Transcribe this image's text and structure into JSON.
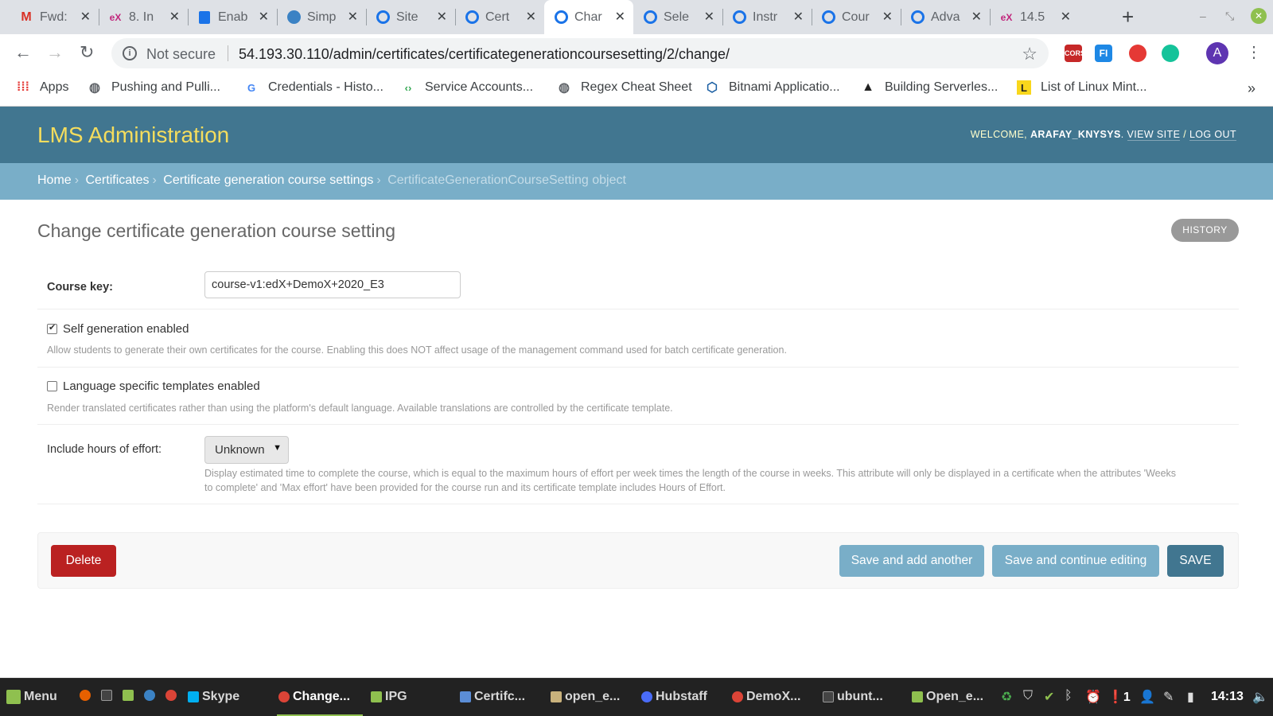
{
  "browser": {
    "tabs": [
      {
        "title": "Fwd:",
        "icon": "gmail-icon"
      },
      {
        "title": "8. In",
        "icon": "edx-icon"
      },
      {
        "title": "Enab",
        "icon": "doc-icon"
      },
      {
        "title": "Simp",
        "icon": "simple-icon"
      },
      {
        "title": "Site",
        "icon": "ring-icon"
      },
      {
        "title": "Cert",
        "icon": "ring-icon"
      },
      {
        "title": "Char",
        "icon": "ring-icon"
      },
      {
        "title": "Sele",
        "icon": "ring-icon"
      },
      {
        "title": "Instr",
        "icon": "ring-icon"
      },
      {
        "title": "Cour",
        "icon": "ring-icon"
      },
      {
        "title": "Adva",
        "icon": "ring-icon"
      },
      {
        "title": "14.5",
        "icon": "edx-icon"
      }
    ],
    "active_tab_index": 6,
    "security_label": "Not secure",
    "url": "54.193.30.110/admin/certificates/certificategenerationcoursesetting/2/change/",
    "avatar_letter": "A",
    "extensions": [
      "CORS",
      "FI",
      "",
      ""
    ],
    "bookmarks": [
      {
        "label": "Apps",
        "icon": "apps-grid-icon"
      },
      {
        "label": "Pushing and Pulli...",
        "icon": "globe-icon"
      },
      {
        "label": "Credentials - Histo...",
        "icon": "google-icon"
      },
      {
        "label": "Service Accounts...",
        "icon": "cloud-icon"
      },
      {
        "label": "Regex Cheat Sheet",
        "icon": "globe-icon"
      },
      {
        "label": "Bitnami Applicatio...",
        "icon": "bitnami-icon"
      },
      {
        "label": "Building Serverles...",
        "icon": "hat-icon"
      },
      {
        "label": "List of Linux Mint...",
        "icon": "l-icon"
      }
    ]
  },
  "admin": {
    "site_title": "LMS Administration",
    "welcome": "WELCOME,",
    "username": "ARAFAY_KNYSYS",
    "view_site": "VIEW SITE",
    "slash": "/",
    "log_out": "LOG OUT",
    "breadcrumbs": [
      "Home",
      "Certificates",
      "Certificate generation course settings"
    ],
    "breadcrumb_current": "CertificateGenerationCourseSetting object",
    "page_title": "Change certificate generation course setting",
    "history": "HISTORY",
    "fields": {
      "course_key": {
        "label": "Course key:",
        "value": "course-v1:edX+DemoX+2020_E3"
      },
      "self_generation": {
        "label": "Self generation enabled",
        "checked": true,
        "help": "Allow students to generate their own certificates for the course. Enabling this does NOT affect usage of the management command used for batch certificate generation."
      },
      "language_specific": {
        "label": "Language specific templates enabled",
        "checked": false,
        "help": "Render translated certificates rather than using the platform's default language. Available translations are controlled by the certificate template."
      },
      "hours_of_effort": {
        "label": "Include hours of effort:",
        "selected": "Unknown",
        "help_line1": "Display estimated time to complete the course, which is equal to the maximum hours of effort per week times the length of the course in weeks. This attribute will only be displayed in a certificate when the attributes 'Weeks",
        "help_line2": "to complete' and 'Max effort' have been provided for the course run and its certificate template includes Hours of Effort."
      }
    },
    "buttons": {
      "delete": "Delete",
      "save_add": "Save and add another",
      "save_continue": "Save and continue editing",
      "save": "SAVE"
    },
    "colors": {
      "header": "#417690",
      "breadcrumbs": "#79aec8",
      "title": "#f5dd5d",
      "delete": "#ba2121"
    }
  },
  "taskbar": {
    "menu": "Menu",
    "items": [
      "Skype",
      "Change...",
      "IPG",
      "Certifc...",
      "open_e...",
      "Hubstaff",
      "DemoX...",
      "ubunt...",
      "Open_e..."
    ],
    "notification_count": "1",
    "clock": "14:13"
  }
}
